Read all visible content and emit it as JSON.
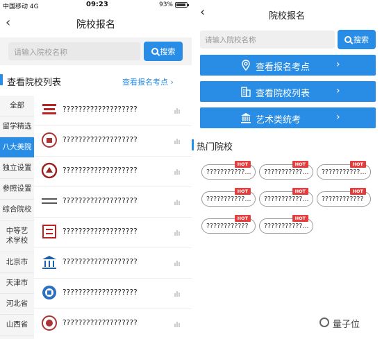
{
  "left": {
    "status": {
      "carrier": "中国移动  4G",
      "time": "09:23",
      "battery": "93%"
    },
    "nav": {
      "back": "‹",
      "title": "院校报名"
    },
    "search": {
      "placeholder": "请输入院校名称",
      "button": "搜索"
    },
    "section": {
      "title": "查看院校列表",
      "link": "查看报名考点  ›"
    },
    "categories": [
      "全部",
      "留学精选",
      "八大美院",
      "独立设置",
      "参照设置",
      "综合院校",
      "中等艺术学校",
      "北京市",
      "天津市",
      "河北省",
      "山西省"
    ],
    "active_category": "八大美院",
    "schools": [
      "???????????????????",
      "???????????????????",
      "???????????????????",
      "???????????????????",
      "???????????????????",
      "???????????????????",
      "???????????????????",
      "???????????????????"
    ]
  },
  "right": {
    "nav": {
      "back": "‹",
      "title": "院校报名"
    },
    "search": {
      "placeholder": "请输入院校名称",
      "button": "搜索"
    },
    "actions": [
      {
        "label": "查看报名考点",
        "icon": "location-pin-icon",
        "chevron": "›"
      },
      {
        "label": "查看院校列表",
        "icon": "building-icon",
        "chevron": "›"
      },
      {
        "label": "艺术类统考",
        "icon": "museum-icon",
        "chevron": "›"
      }
    ],
    "hot_title": "热门院校",
    "hot_badge": "HOT",
    "hot_schools": [
      "???????????...",
      "???????????...",
      "???????????...",
      "???????????...",
      "???????????...",
      "????????????",
      "????????????",
      "???????????..."
    ]
  },
  "brand": "量子位",
  "colors": {
    "accent": "#2a8de5",
    "hot": "#e43d3d"
  }
}
